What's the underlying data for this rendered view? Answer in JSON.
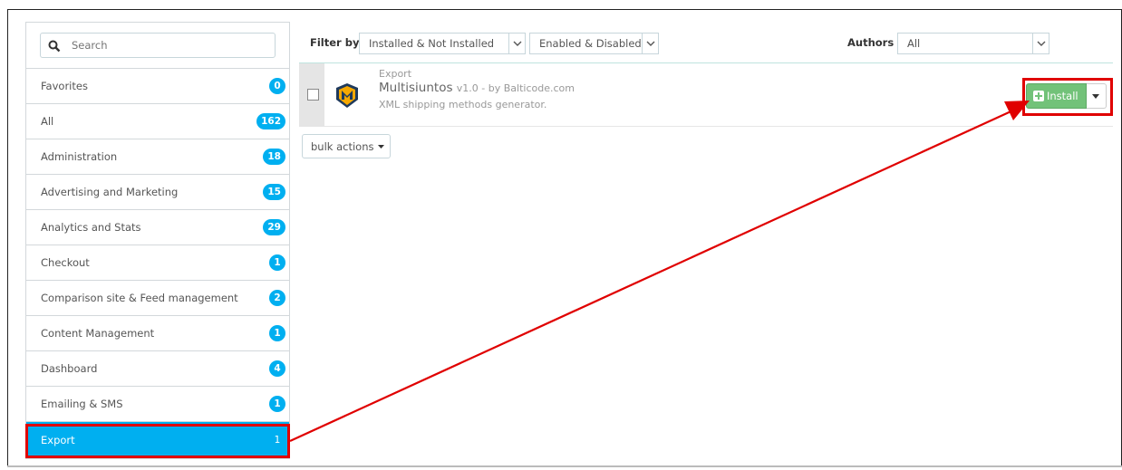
{
  "sidebar": {
    "search": {
      "placeholder": "Search",
      "icon": "search-icon"
    },
    "categories": [
      {
        "label": "Favorites",
        "count": "0"
      },
      {
        "label": "All",
        "count": "162"
      },
      {
        "label": "Administration",
        "count": "18"
      },
      {
        "label": "Advertising and Marketing",
        "count": "15"
      },
      {
        "label": "Analytics and Stats",
        "count": "29"
      },
      {
        "label": "Checkout",
        "count": "1"
      },
      {
        "label": "Comparison site & Feed management",
        "count": "2"
      },
      {
        "label": "Content Management",
        "count": "1"
      },
      {
        "label": "Dashboard",
        "count": "4"
      },
      {
        "label": "Emailing & SMS",
        "count": "1"
      },
      {
        "label": "Export",
        "count": "1",
        "active": true
      }
    ]
  },
  "filters": {
    "filter_by_label": "Filter by",
    "install_select": "Installed & Not Installed",
    "enabled_select": "Enabled & Disabled",
    "authors_label": "Authors",
    "authors_select": "All"
  },
  "module": {
    "category": "Export",
    "name": "Multisiuntos",
    "version_author": "v1.0 - by Balticode.com",
    "description": "XML shipping methods generator.",
    "install_label": "Install"
  },
  "bulk_actions_label": "bulk actions",
  "colors": {
    "accent": "#00aff0",
    "install_green": "#72c279",
    "highlight_red": "#e00000"
  }
}
